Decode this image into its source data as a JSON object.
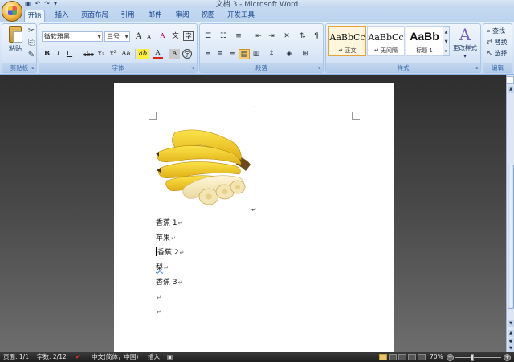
{
  "window": {
    "title": "文档 3 - Microsoft Word"
  },
  "qat": {
    "save_icon": "save-icon",
    "undo_icon": "undo-icon",
    "redo_icon": "redo-icon",
    "more": "▾"
  },
  "tabs": [
    {
      "label": "开始",
      "active": true
    },
    {
      "label": "插入"
    },
    {
      "label": "页面布局"
    },
    {
      "label": "引用"
    },
    {
      "label": "邮件"
    },
    {
      "label": "审阅"
    },
    {
      "label": "视图"
    },
    {
      "label": "开发工具"
    }
  ],
  "clipboard": {
    "paste_label": "粘贴",
    "group_label": "剪贴板"
  },
  "font": {
    "name": "微软雅黑",
    "size": "三号",
    "group_label": "字体",
    "bold": "B",
    "italic": "I",
    "underline": "U",
    "strike": "abc",
    "subscript": "x₂",
    "superscript": "x²",
    "change_case": "Aa",
    "grow": "A",
    "shrink": "A",
    "clear": "A",
    "phonetic": "文",
    "highlight": "ab",
    "color": "A",
    "char_shade": "A",
    "enclose": "字"
  },
  "paragraph": {
    "group_label": "段落"
  },
  "styles": {
    "group_label": "样式",
    "items": [
      {
        "sample": "AaBbCc",
        "name": "↵ 正文",
        "selected": true
      },
      {
        "sample": "AaBbCc",
        "name": "↵ 无间隔"
      },
      {
        "sample": "AaBb",
        "name": "标题 1"
      }
    ],
    "change_styles_label": "更改样式"
  },
  "editing": {
    "group_label": "编辑",
    "find": "查找",
    "replace": "替换",
    "select": "选择"
  },
  "document": {
    "image_alt": "bunch of bananas with peeled slices",
    "lines": [
      {
        "text": "香蕉 1",
        "mark": "↵"
      },
      {
        "text": "苹果",
        "mark": "↵"
      },
      {
        "text": "香蕉 2",
        "mark": "↵",
        "cursor": true
      },
      {
        "text": "梨",
        "mark": "↵",
        "squiggle": true
      },
      {
        "text": "香蕉 3",
        "mark": "↵"
      },
      {
        "text": "",
        "mark": "↵"
      },
      {
        "text": "",
        "mark": "↵"
      }
    ],
    "image_mark": "↵"
  },
  "status": {
    "page": "页面: 1/1",
    "words": "字数: 2/12",
    "language": "中文(简体，中国)",
    "mode": "插入",
    "zoom": "70%"
  }
}
